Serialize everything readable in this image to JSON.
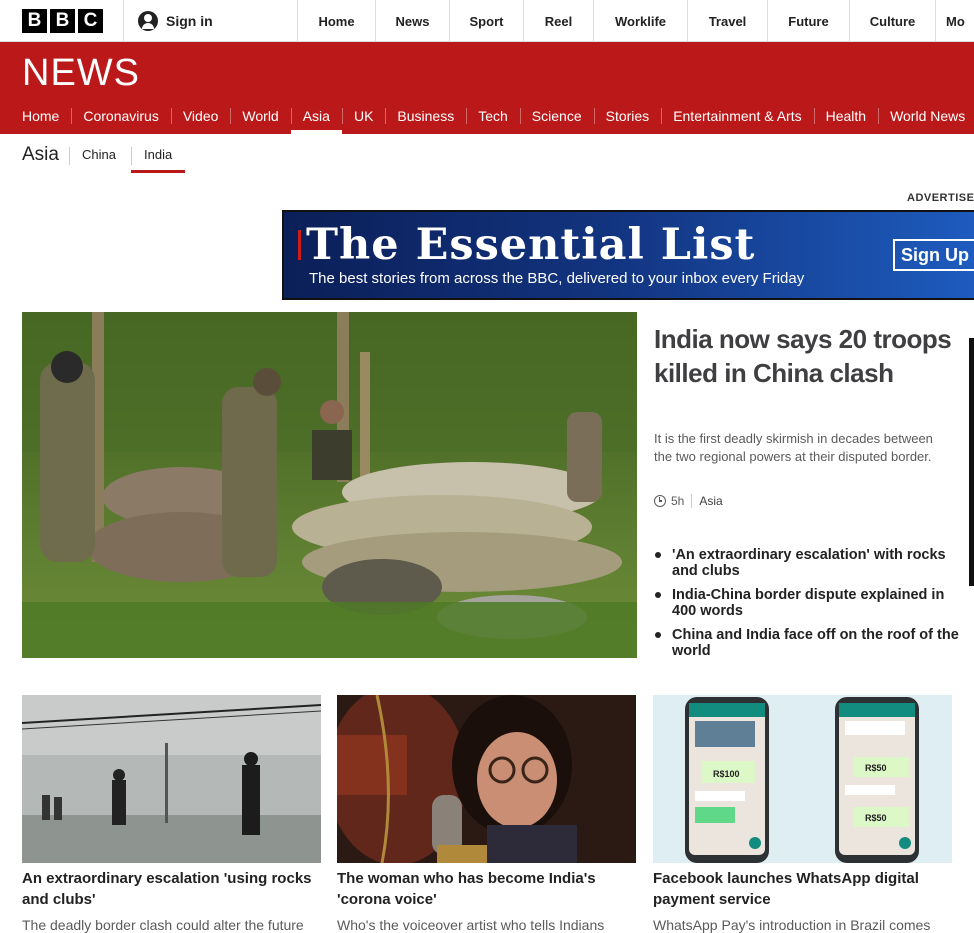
{
  "brand": {
    "letters": [
      "B",
      "B",
      "C"
    ]
  },
  "topbar": {
    "signin_label": "Sign in",
    "nav": [
      "Home",
      "News",
      "Sport",
      "Reel",
      "Worklife",
      "Travel",
      "Future",
      "Culture",
      "Mo"
    ]
  },
  "masthead": {
    "title": "NEWS",
    "nav": [
      "Home",
      "Coronavirus",
      "Video",
      "World",
      "Asia",
      "UK",
      "Business",
      "Tech",
      "Science",
      "Stories",
      "Entertainment & Arts",
      "Health",
      "World News"
    ],
    "active": "Asia"
  },
  "section": {
    "title": "Asia",
    "links": [
      "China",
      "India"
    ],
    "active": "India"
  },
  "ad": {
    "label": "ADVERTISE",
    "title": "The Essential List",
    "subtitle": "The best stories from across the BBC, delivered to your inbox every Friday",
    "button": "Sign Up"
  },
  "lead": {
    "headline": "India now says 20 troops killed in China clash",
    "summary": "It is the first deadly skirmish in decades between the two regional powers at their disputed border.",
    "time": "5h",
    "tag": "Asia",
    "related": [
      "'An extraordinary escalation' with rocks and clubs",
      "India-China border dispute explained in 400 words",
      "China and India face off on the roof of the world"
    ]
  },
  "cards": [
    {
      "title": "An extraordinary escalation 'using rocks and clubs'",
      "summary": "The deadly border clash could alter the future"
    },
    {
      "title": "The woman who has become India's 'corona voice'",
      "summary": "Who's the voiceover artist who tells Indians"
    },
    {
      "title": "Facebook launches WhatsApp digital payment service",
      "summary": "WhatsApp Pay's introduction in Brazil comes"
    }
  ],
  "phone_screens": {
    "amount_left": "R$100",
    "amount_right": "R$50"
  },
  "colors": {
    "brand_red": "#bb1919",
    "ad_blue": "#12337e",
    "headline_grey": "#3f3f42"
  }
}
